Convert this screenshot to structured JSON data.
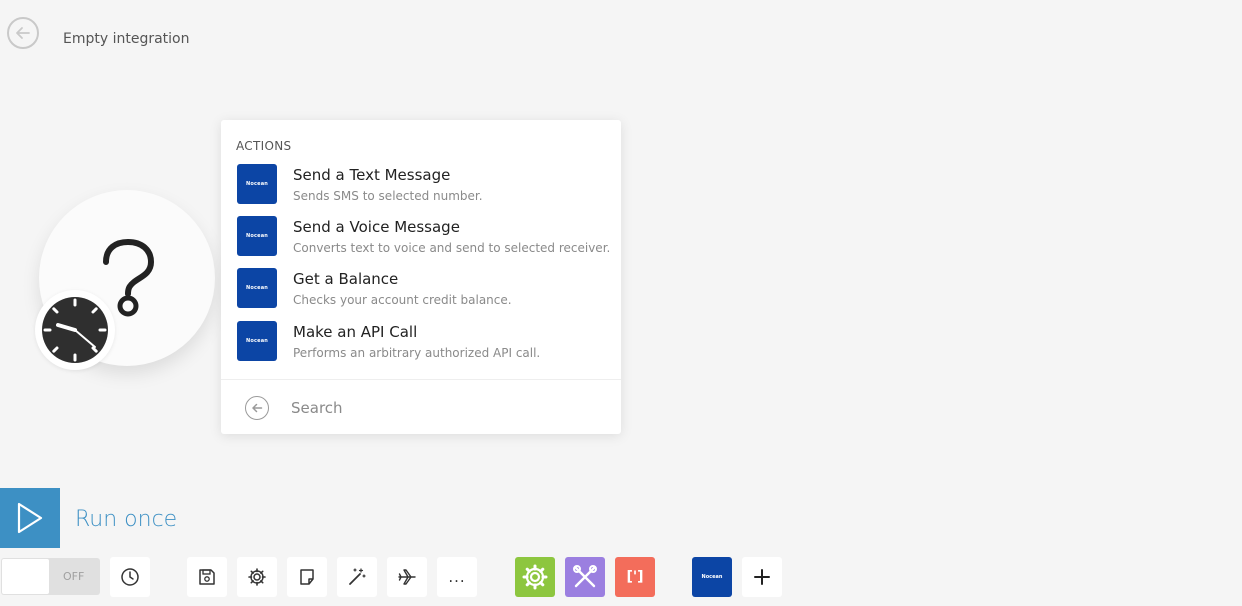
{
  "header": {
    "title": "Empty integration"
  },
  "module": {
    "trigger_icon": "question-mark-icon",
    "schedule_icon": "clock-icon"
  },
  "actions_panel": {
    "heading": "ACTIONS",
    "items": [
      {
        "title": "Send a Text Message",
        "description": "Sends SMS to selected number.",
        "logo_text": "Nocean"
      },
      {
        "title": "Send a Voice Message",
        "description": "Converts text to voice and send to selected receiver.",
        "logo_text": "Nocean"
      },
      {
        "title": "Get a Balance",
        "description": "Checks your account credit balance.",
        "logo_text": "Nocean"
      },
      {
        "title": "Make an API Call",
        "description": "Performs an arbitrary authorized API call.",
        "logo_text": "Nocean"
      }
    ],
    "search": {
      "placeholder": "Search",
      "value": ""
    }
  },
  "run": {
    "label": "Run once"
  },
  "toolbar": {
    "toggle_label": "OFF",
    "ellipsis": "...",
    "brackets": "[']",
    "app_logo_text": "Nocean",
    "add_symbol": "+"
  },
  "colors": {
    "accent": "#3d90c4",
    "app_brand": "#0c45a5",
    "tools_green": "#8dc63f",
    "flow_purple": "#9b7fe0",
    "text_parser_orange": "#f36d5b",
    "background": "#f5f5f5"
  }
}
